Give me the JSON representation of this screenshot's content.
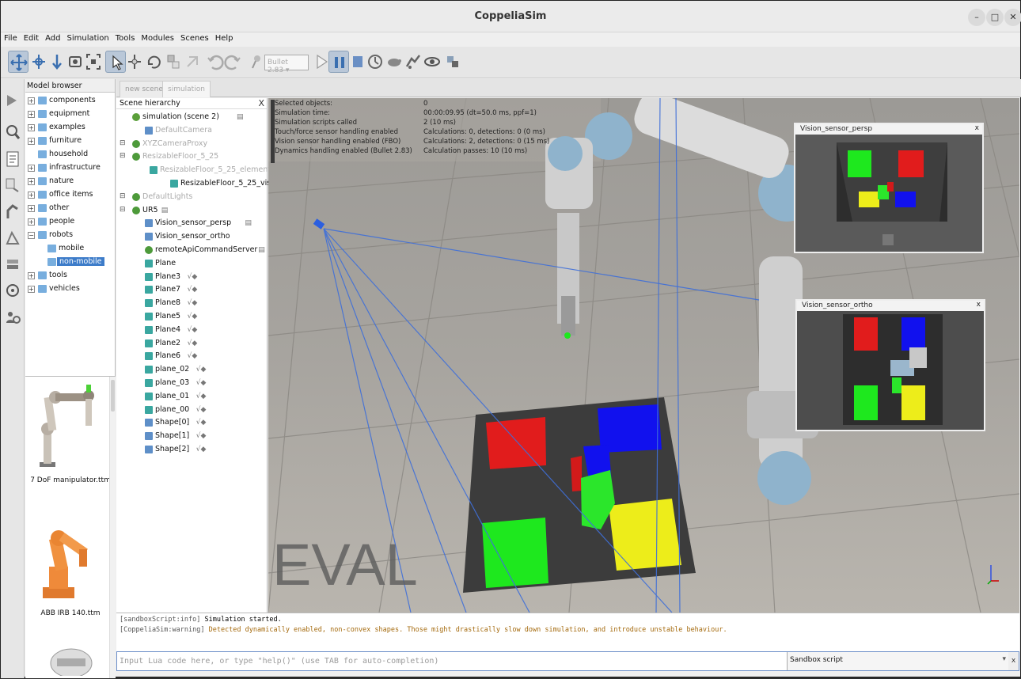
{
  "window": {
    "title": "CoppeliaSim"
  },
  "menu": [
    "File",
    "Edit",
    "Add",
    "Simulation",
    "Tools",
    "Modules",
    "Scenes",
    "Help"
  ],
  "toolbar": {
    "engine": "Bullet 2.83"
  },
  "model_browser": {
    "title": "Model browser",
    "folders": [
      "components",
      "equipment",
      "examples",
      "furniture",
      "household",
      "infrastructure",
      "nature",
      "office items",
      "other",
      "people",
      "robots",
      "mobile",
      "non-mobile",
      "tools",
      "vehicles"
    ],
    "thumbnails": [
      "7 DoF manipulator.ttm",
      "ABB IRB 140.ttm"
    ]
  },
  "scene_tabs": [
    "new scene",
    "simulation"
  ],
  "scene_hierarchy": {
    "title": "Scene hierarchy",
    "close": "X",
    "items": [
      "simulation (scene 2)",
      "DefaultCamera",
      "XYZCameraProxy",
      "ResizableFloor_5_25",
      "ResizableFloor_5_25_element",
      "ResizableFloor_5_25_visibleElement",
      "DefaultLights",
      "UR5",
      "Vision_sensor_persp",
      "Vision_sensor_ortho",
      "remoteApiCommandServer",
      "Plane",
      "Plane3",
      "Plane7",
      "Plane8",
      "Plane5",
      "Plane4",
      "Plane2",
      "Plane6",
      "plane_02",
      "plane_03",
      "plane_01",
      "plane_00",
      "Shape[0]",
      "Shape[1]",
      "Shape[2]"
    ]
  },
  "sim_info": {
    "labels": [
      "Selected objects:",
      "Simulation time:",
      "Simulation scripts called",
      "Touch/force sensor handling enabled",
      "Vision sensor handling enabled (FBO)",
      "Dynamics handling enabled (Bullet 2.83)"
    ],
    "values": [
      "0",
      "00:00:09.95 (dt=50.0 ms, ppf=1)",
      "2 (10 ms)",
      "Calculations: 0, detections: 0 (0 ms)",
      "Calculations: 2, detections: 0 (15 ms)",
      "Calculation passes: 10 (10 ms)"
    ]
  },
  "viewport": {
    "watermark": "EVAL"
  },
  "sensor_views": {
    "persp": "Vision_sensor_persp",
    "ortho": "Vision_sensor_ortho",
    "close": "x"
  },
  "console": {
    "line1_tag": "[sandboxScript:info]",
    "line1_text": "Simulation started.",
    "line2_tag": "[CoppeliaSim:warning]",
    "line2_text": "Detected dynamically enabled, non-convex shapes. Those might drastically slow down simulation, and introduce unstable behaviour."
  },
  "lua_input": {
    "placeholder": "Input Lua code here, or type \"help()\" (use TAB for auto-completion)"
  },
  "script_selector": {
    "value": "Sandbox script",
    "close": "x"
  }
}
